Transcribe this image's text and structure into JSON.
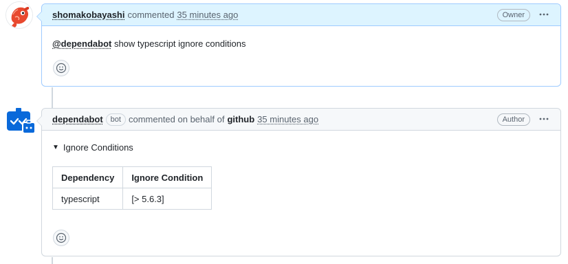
{
  "comments": [
    {
      "author": "shomakobayashi",
      "action": "commented",
      "time": "35 minutes ago",
      "badge": "Owner",
      "mention": "@dependabot",
      "body_text": " show typescript ignore conditions",
      "more_icon": "kebab-horizontal-icon",
      "reaction_icon": "smiley-icon"
    },
    {
      "author": "dependabot",
      "bot_label": "bot",
      "action": "commented on behalf of",
      "org": "github",
      "time": "35 minutes ago",
      "badge": "Author",
      "summary": "Ignore Conditions",
      "table": {
        "headers": [
          "Dependency",
          "Ignore Condition"
        ],
        "rows": [
          [
            "typescript",
            "[> 5.6.3]"
          ]
        ]
      },
      "more_icon": "kebab-horizontal-icon",
      "reaction_icon": "smiley-icon"
    }
  ],
  "colors": {
    "owner_header_bg": "#ddf4ff",
    "owner_border": "#9ecbff",
    "header_bg": "#f6f8fa",
    "border": "#d0d7de",
    "bot_avatar": "#0969da"
  }
}
